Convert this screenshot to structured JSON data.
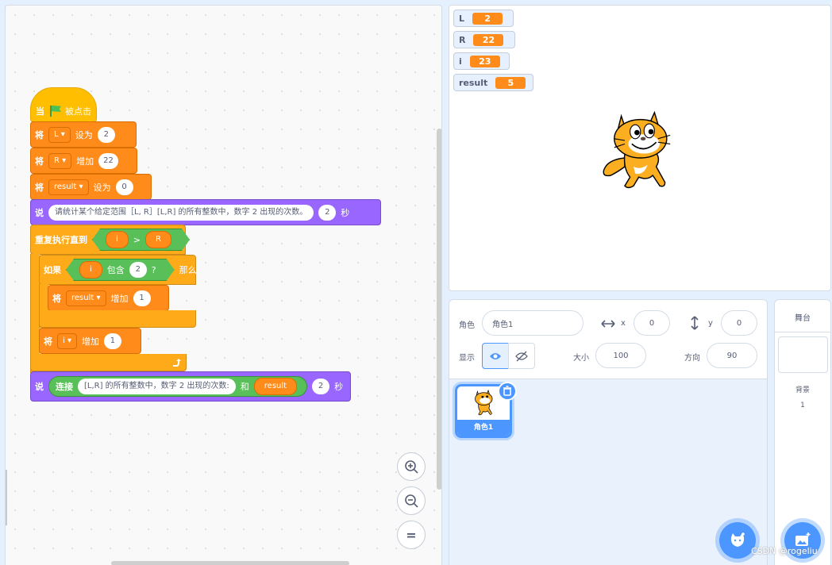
{
  "code": {
    "hat": {
      "when": "当",
      "clicked": "被点击"
    },
    "set_l": {
      "verb": "将",
      "var": "L",
      "op": "设为",
      "value": "2"
    },
    "change_r": {
      "verb": "将",
      "var": "R",
      "op": "增加",
      "value": "22"
    },
    "set_result": {
      "verb": "将",
      "var": "result",
      "op": "设为",
      "value": "0"
    },
    "say1": {
      "verb": "说",
      "text": "请统计某个给定范围［L, R］[L,R] 的所有整数中，数字 2 出现的次数。",
      "secs": "2",
      "unit": "秒"
    },
    "repeat": {
      "label": "重复执行直到",
      "left": "i",
      "op": ">",
      "right": "R"
    },
    "if": {
      "label": "如果",
      "var": "i",
      "contains": "包含",
      "value": "2",
      "q": "?",
      "then": "那么"
    },
    "change_result": {
      "verb": "将",
      "var": "result",
      "op": "增加",
      "value": "1"
    },
    "change_i": {
      "verb": "将",
      "var": "i",
      "op": "增加",
      "value": "1"
    },
    "say2": {
      "verb": "说",
      "join": "连接",
      "text": "[L,R] 的所有整数中，数字 2 出现的次数:",
      "and": "和",
      "var": "result",
      "secs": "2",
      "unit": "秒"
    },
    "zoom": {
      "in": "+",
      "out": "−",
      "reset": "="
    }
  },
  "monitors": [
    {
      "name": "L",
      "value": "2"
    },
    {
      "name": "R",
      "value": "22"
    },
    {
      "name": "i",
      "value": "23"
    },
    {
      "name": "result",
      "value": "5"
    }
  ],
  "sprite_info": {
    "sprite_label": "角色",
    "sprite_name": "角色1",
    "x_label": "x",
    "x_value": "0",
    "y_label": "y",
    "y_value": "0",
    "show_label": "显示",
    "size_label": "大小",
    "size_value": "100",
    "direction_label": "方向",
    "direction_value": "90"
  },
  "sprites": [
    {
      "name": "角色1"
    }
  ],
  "stage_panel": {
    "title": "舞台",
    "backdrops_label": "背景",
    "backdrops_count": "1"
  },
  "watermark": "CSDN @rogeliu",
  "colors": {
    "events": "#ffbf00",
    "variables": "#ff8c1a",
    "looks": "#9966ff",
    "control": "#ffab19",
    "operators": "#59c059",
    "accent": "#4c97ff"
  }
}
